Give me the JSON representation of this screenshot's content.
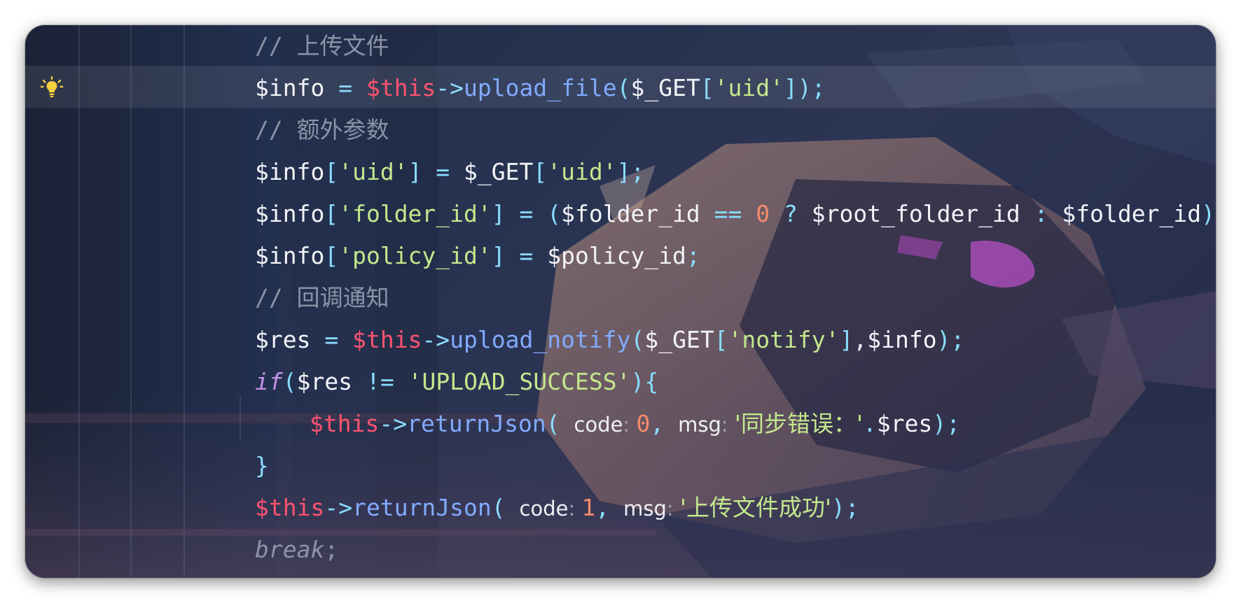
{
  "editor": {
    "gutter_icon": "lightbulb-icon",
    "lines": [
      {
        "comment": "// 上传文件"
      },
      {
        "var": "$info",
        "eq": " = ",
        "this": "$this",
        "arrow": "->",
        "fn": "upload_file",
        "open": "(",
        "arg1": "$_GET",
        "lb": "[",
        "key": "'uid'",
        "rb": "]",
        "close": ");"
      },
      {
        "comment": "// 额外参数"
      },
      {
        "var": "$info",
        "lb": "[",
        "key": "'uid'",
        "rb": "]",
        "eq": " = ",
        "var2": "$_GET",
        "lb2": "[",
        "key2": "'uid'",
        "rb2": "];"
      },
      {
        "var": "$info",
        "lb": "[",
        "key": "'folder_id'",
        "rb": "]",
        "eq": " = ",
        "open": "(",
        "var2": "$folder_id",
        "cmp": " == ",
        "num": "0",
        "q": " ? ",
        "var3": "$root_folder_id",
        "c": " : ",
        "var4": "$folder_id",
        "close": ");"
      },
      {
        "var": "$info",
        "lb": "[",
        "key": "'policy_id'",
        "rb": "]",
        "eq": " = ",
        "var2": "$policy_id",
        "semi": ";"
      },
      {
        "comment": "// 回调通知"
      },
      {
        "var": "$res",
        "eq": " = ",
        "this": "$this",
        "arrow": "->",
        "fn": "upload_notify",
        "open": "(",
        "arg1": "$_GET",
        "lb": "[",
        "key": "'notify'",
        "rb": "]",
        "comma": ",",
        "arg2": "$info",
        "close": ");"
      },
      {
        "kw": "if",
        "open": "(",
        "var": "$res",
        "ne": " != ",
        "str": "'UPLOAD_SUCCESS'",
        "close": "){"
      },
      {
        "this": "$this",
        "arrow": "->",
        "fn": "returnJson",
        "open": "( ",
        "hint1": "code",
        "hc1": ": ",
        "num": "0",
        "comma": ", ",
        "hint2": "msg",
        "hc2": ": ",
        "str": "'同步错误：'",
        "concat": ".",
        "var": "$res",
        "close": ");"
      },
      {
        "brace": "}"
      },
      {
        "this": "$this",
        "arrow": "->",
        "fn": "returnJson",
        "open": "( ",
        "hint1": "code",
        "hc1": ": ",
        "num": "1",
        "comma": ", ",
        "hint2": "msg",
        "hc2": ": ",
        "str": "'上传文件成功'",
        "close": ");"
      },
      {
        "kw": "break",
        "semi": ";"
      }
    ]
  },
  "colors": {
    "background": "#263250",
    "keyword_this": "#ff5370",
    "function": "#82aaff",
    "string": "#c3e88d",
    "number": "#f78c6c",
    "operator": "#89ddff",
    "control": "#c792ea",
    "comment": "#8b93a6"
  }
}
